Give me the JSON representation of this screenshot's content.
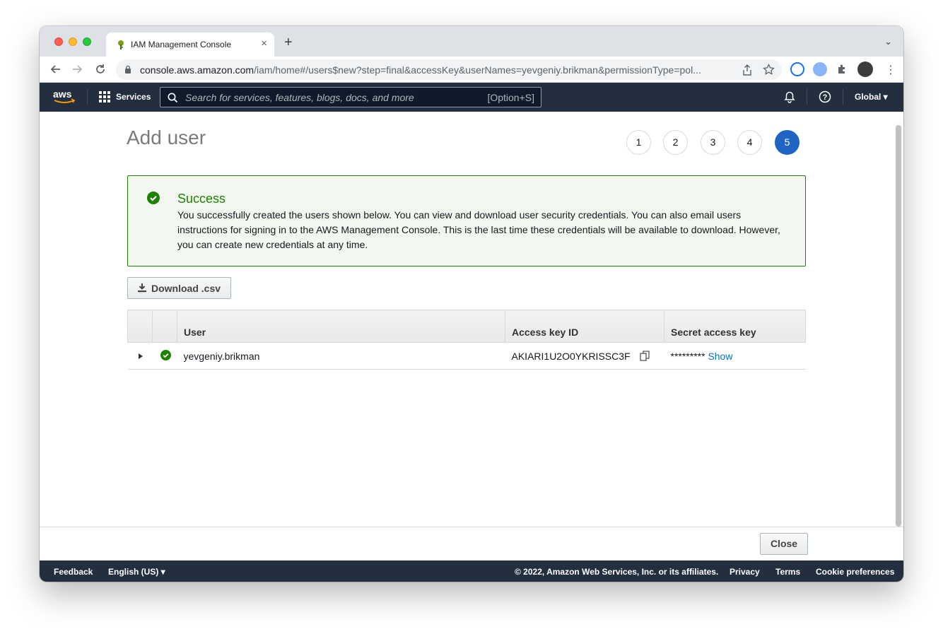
{
  "browser": {
    "tab_title": "IAM Management Console",
    "tab_close": "×",
    "new_tab": "+",
    "tab_search": "⌄",
    "url_host": "console.aws.amazon.com",
    "url_path": "/iam/home#/users$new?step=final&accessKey&userNames=yevgeniy.brikman&permissionType=pol..."
  },
  "aws_nav": {
    "services_label": "Services",
    "search_placeholder": "Search for services, features, blogs, docs, and more",
    "search_shortcut": "[Option+S]",
    "region_label": "Global ▾"
  },
  "page": {
    "title": "Add user",
    "steps": [
      "1",
      "2",
      "3",
      "4",
      "5"
    ],
    "active_step": "5"
  },
  "success": {
    "title": "Success",
    "message": "You successfully created the users shown below. You can view and download user security credentials. You can also email users instructions for signing in to the AWS Management Console. This is the last time these credentials will be available to download. However, you can create new credentials at any time."
  },
  "download_button": "Download .csv",
  "table": {
    "columns": [
      "User",
      "Access key ID",
      "Secret access key"
    ],
    "rows": [
      {
        "user": "yevgeniy.brikman",
        "access_key_id": "AKIARI1U2O0YKRISSC3F",
        "secret_mask": "*********",
        "secret_show": "Show"
      }
    ]
  },
  "close_button": "Close",
  "footer": {
    "feedback": "Feedback",
    "language": "English (US) ▾",
    "copyright": "© 2022, Amazon Web Services, Inc. or its affiliates.",
    "privacy": "Privacy",
    "terms": "Terms",
    "cookies": "Cookie preferences"
  },
  "colors": {
    "aws_nav": "#232f3e",
    "success": "#1d8102",
    "active_step": "#1f64c2",
    "link": "#0073bb"
  }
}
